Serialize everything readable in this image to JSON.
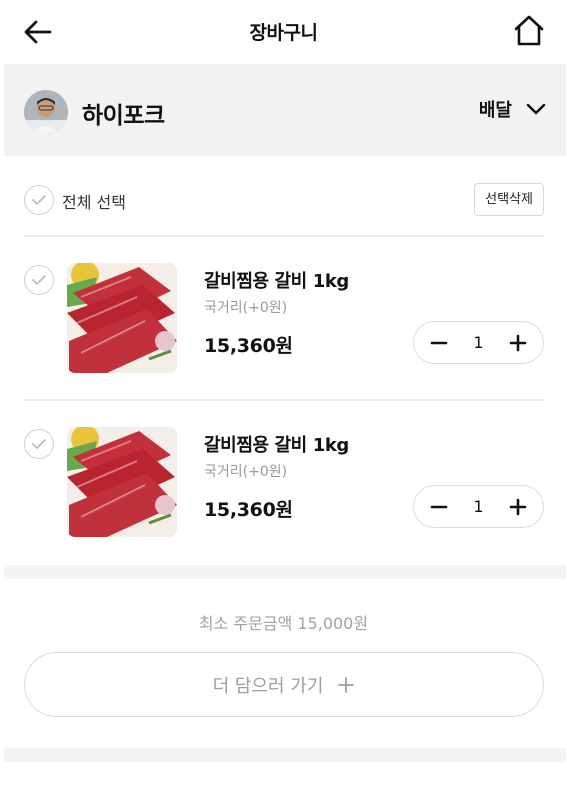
{
  "header": {
    "title": "장바구니",
    "back_icon": "arrow-left-icon",
    "home_icon": "home-icon"
  },
  "store": {
    "name": "하이포크",
    "delivery_label": "배달",
    "dropdown_icon": "chevron-down-icon"
  },
  "select_all": {
    "label": "전체 선택",
    "delete_button": "선택삭제"
  },
  "items": [
    {
      "name": "갈비찜용 갈비 1kg",
      "option": "국거리(+0원)",
      "price": "15,360원",
      "quantity": "1"
    },
    {
      "name": "갈비찜용 갈비 1kg",
      "option": "국거리(+0원)",
      "price": "15,360원",
      "quantity": "1"
    }
  ],
  "min_order": "최소 주문금액 15,000원",
  "add_more": {
    "label": "더 담으러 가기",
    "icon": "plus-icon"
  },
  "colors": {
    "accent_text": "#111111",
    "muted_text": "#9a9a9a",
    "section_bg": "#f2f2f2",
    "border": "#dcdcdc"
  }
}
